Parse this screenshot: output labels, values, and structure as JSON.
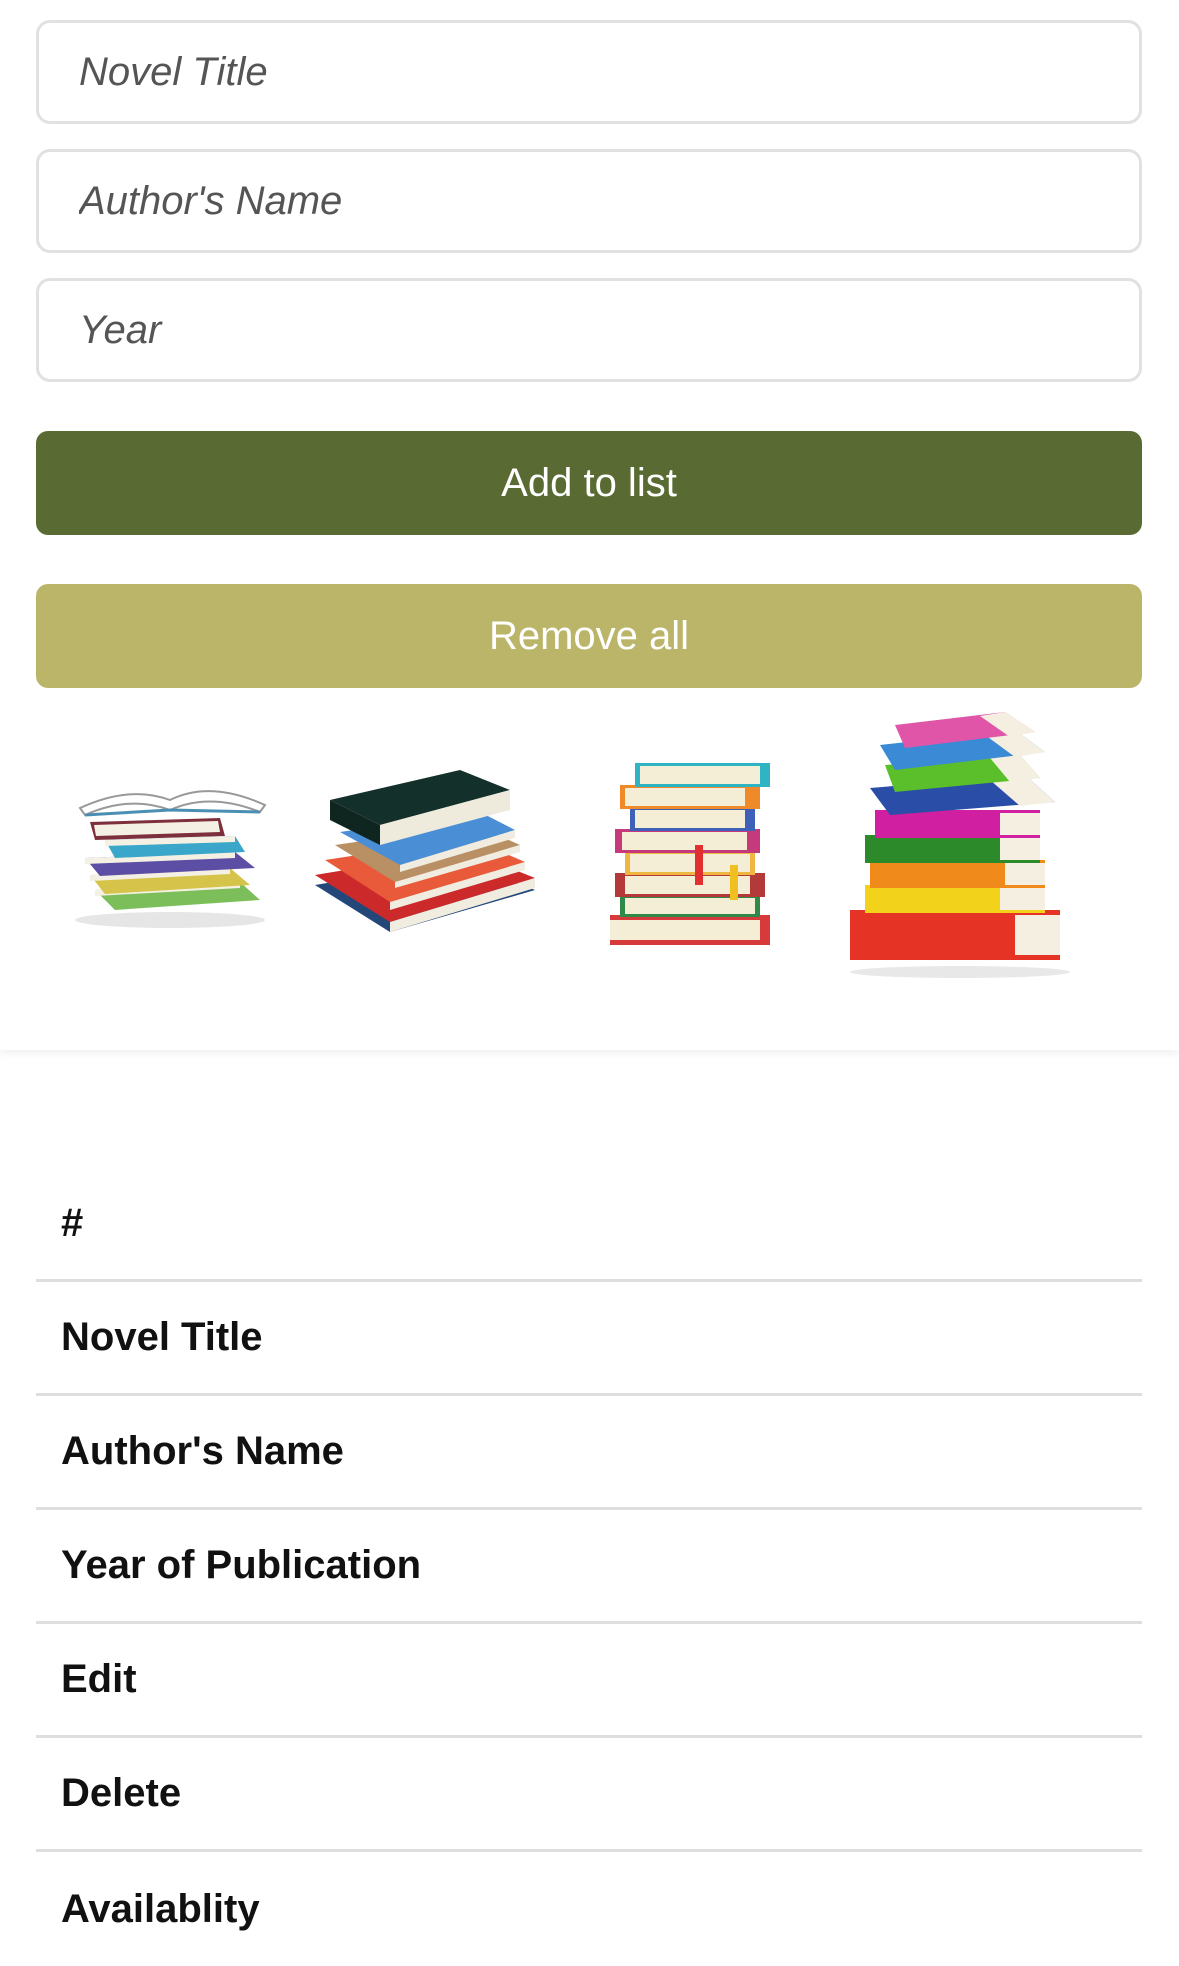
{
  "form": {
    "title_placeholder": "Novel Title",
    "author_placeholder": "Author's Name",
    "year_placeholder": "Year",
    "title_value": "",
    "author_value": "",
    "year_value": ""
  },
  "buttons": {
    "add_label": "Add to list",
    "remove_label": "Remove all"
  },
  "colors": {
    "add_button": "#596b33",
    "remove_button": "#bbb56a"
  },
  "images": [
    {
      "name": "book-stack-open-icon"
    },
    {
      "name": "book-stack-dark-icon"
    },
    {
      "name": "book-stack-bookmarks-icon"
    },
    {
      "name": "book-stack-colorful-icon"
    }
  ],
  "table": {
    "headers": [
      "#",
      "Novel Title",
      "Author's Name",
      "Year of Publication",
      "Edit",
      "Delete",
      "Availablity"
    ]
  }
}
